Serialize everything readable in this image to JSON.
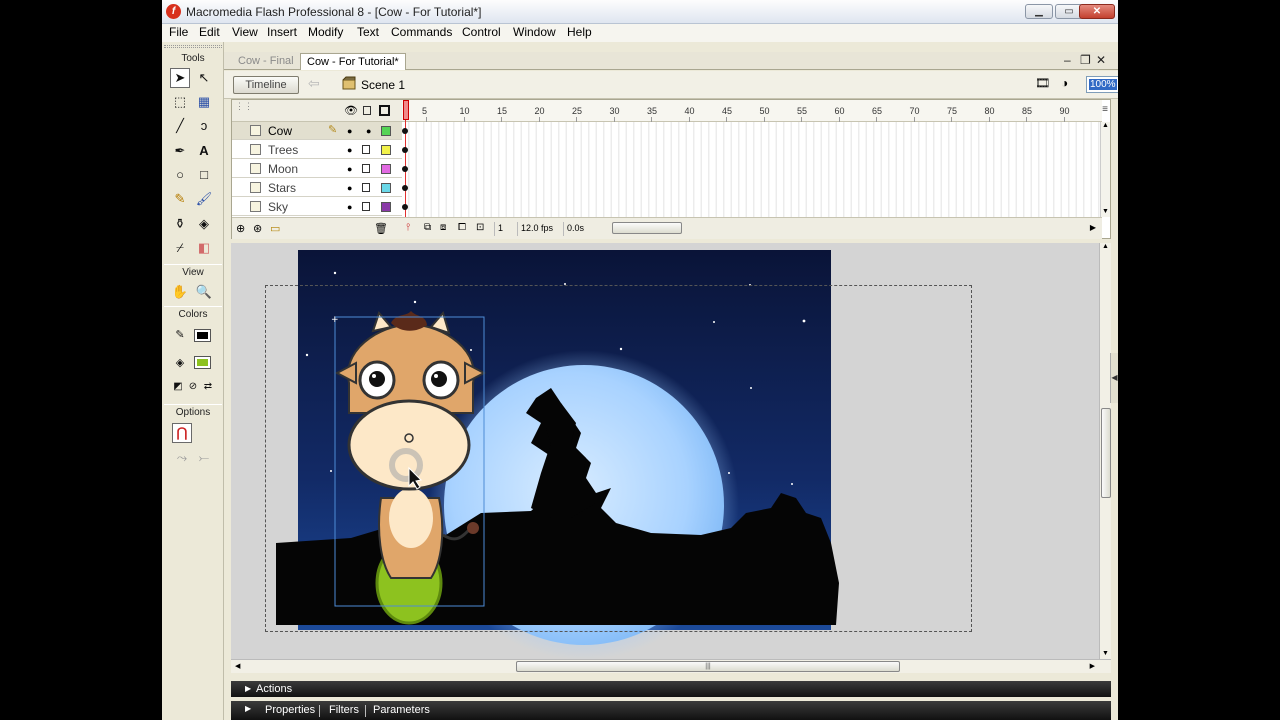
{
  "window": {
    "title": "Macromedia Flash Professional 8 - [Cow - For Tutorial*]",
    "controls": {
      "minimize": "▁",
      "maximize": "▭",
      "close": "✕"
    }
  },
  "menu": [
    "File",
    "Edit",
    "View",
    "Insert",
    "Modify",
    "Text",
    "Commands",
    "Control",
    "Window",
    "Help"
  ],
  "tools": {
    "title": "Tools",
    "view_label": "View",
    "colors_label": "Colors",
    "options_label": "Options",
    "stroke_color": "#000000",
    "fill_color": "#8dc21f"
  },
  "doc_tabs": [
    {
      "label": "Cow - Final",
      "active": false
    },
    {
      "label": "Cow - For Tutorial*",
      "active": true
    }
  ],
  "doc_controls": {
    "minimize": "‒",
    "restore": "❐",
    "close": "✕"
  },
  "edit_bar": {
    "timeline_label": "Timeline",
    "scene_label": "Scene 1",
    "zoom": "100%"
  },
  "timeline": {
    "layers": [
      {
        "name": "Cow",
        "color": "#55d455",
        "active": true
      },
      {
        "name": "Trees",
        "color": "#f2f24a",
        "active": false
      },
      {
        "name": "Moon",
        "color": "#e26ae2",
        "active": false
      },
      {
        "name": "Stars",
        "color": "#6ad8e8",
        "active": false
      },
      {
        "name": "Sky",
        "color": "#8a3aa8",
        "active": false
      }
    ],
    "ruler": [
      "5",
      "10",
      "15",
      "20",
      "25",
      "30",
      "35",
      "40",
      "45",
      "50",
      "55",
      "60",
      "65",
      "70",
      "75",
      "80",
      "85",
      "90"
    ],
    "current_frame": "1",
    "fps": "12.0 fps",
    "elapsed": "0.0s"
  },
  "panels": {
    "actions": "Actions",
    "properties": "Properties",
    "filters": "Filters",
    "parameters": "Parameters"
  },
  "stage": {
    "sky_color": "#0c1a45",
    "moon_color": "#aad4ff"
  }
}
